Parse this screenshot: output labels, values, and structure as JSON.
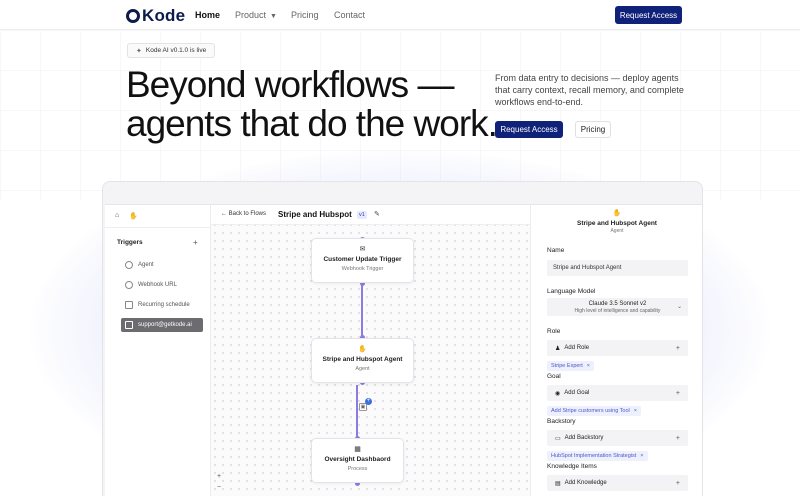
{
  "nav": {
    "logo_text": "Kode",
    "links": [
      "Home",
      "Product",
      "Pricing",
      "Contact"
    ],
    "cta": "Request Access"
  },
  "hero": {
    "badge": "Kode AI v0.1.0 is live",
    "headline_line1": "Beyond workflows —",
    "headline_line2": "agents that do the work.",
    "subtext": "From data entry to decisions — deploy agents that carry context, recall memory, and complete workflows end-to-end.",
    "cta_primary": "Request Access",
    "cta_secondary": "Pricing"
  },
  "app": {
    "sidebar": {
      "section": "Triggers",
      "items": [
        "Agent",
        "Webhook URL",
        "Recurring schedule",
        "support@getkode.ai"
      ]
    },
    "topbar": {
      "back": "Back to Flows",
      "title": "Stripe and Hubspot",
      "version": "v1"
    },
    "nodes": [
      {
        "title": "Customer Update Trigger",
        "subtitle": "Webhook Trigger"
      },
      {
        "title": "Stripe and Hubspot Agent",
        "subtitle": "Agent"
      },
      {
        "title": "Oversight Dashbaord",
        "subtitle": "Process"
      }
    ],
    "panel": {
      "title": "Stripe and Hubspot Agent",
      "subtitle": "Agent",
      "name_label": "Name",
      "name_value": "Stripe and Hubspot Agent",
      "model_label": "Language Model",
      "model_value": "Claude 3.5 Sonnet v2",
      "model_desc": "High level of intelligence and capability",
      "role_label": "Role",
      "add_role": "Add Role",
      "role_chip": "Stripe Expert",
      "goal_label": "Goal",
      "add_goal": "Add Goal",
      "goal_chip": "Add Stripe customers using Tool",
      "backstory_label": "Backstory",
      "add_backstory": "Add Backstory",
      "backstory_chip": "HubSpot Implementation Strategist",
      "knowledge_label": "Knowledge Items",
      "add_knowledge": "Add Knowledge"
    }
  }
}
